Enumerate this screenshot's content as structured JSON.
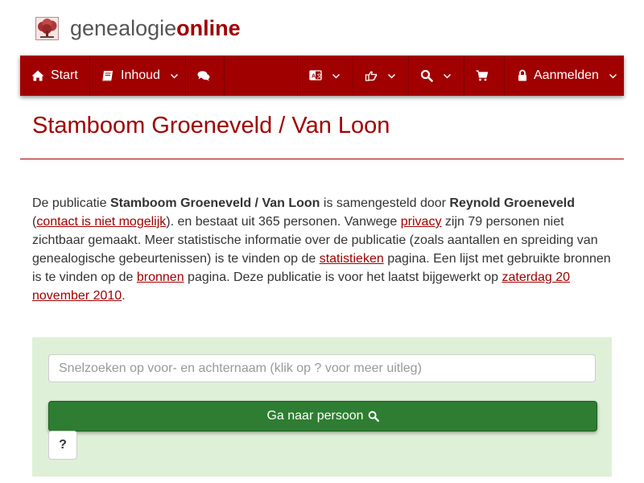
{
  "logo": {
    "text_plain": "genealogie",
    "text_bold": "online",
    "icon": "tree-icon"
  },
  "navbar": {
    "start": {
      "label": "Start",
      "icon": "home-icon"
    },
    "inhoud": {
      "label": "Inhoud",
      "icon": "book-icon"
    },
    "chat_icon": "comments-icon",
    "language_icon": "language-icon",
    "hand_icon": "hand-pointer-icon",
    "search_icon": "search-icon",
    "cart_icon": "shopping-cart-icon",
    "login": {
      "label": "Aanmelden",
      "icon": "lock-icon"
    }
  },
  "page": {
    "title": "Stamboom Groeneveld / Van Loon"
  },
  "intro": {
    "t1": "De publicatie ",
    "publication": "Stamboom Groeneveld / Van Loon",
    "t2": " is samengesteld door ",
    "author": "Reynold Groeneveld",
    "t3": " (",
    "contact_link": "contact is niet mogelijk",
    "t4": "). en bestaat uit 365 personen. Vanwege ",
    "privacy_link": "privacy",
    "t5": " zijn 79 personen niet zichtbaar gemaakt. Meer statistische informatie over de publicatie (zoals aantallen en spreiding van genealogische gebeurtenissen) is te vinden op de ",
    "stats_link": "statistieken",
    "t6": " pagina. Een lijst met gebruikte bronnen is te vinden op de ",
    "sources_link": "bronnen",
    "t7": " pagina. Deze publicatie is voor het laatst bijgewerkt op ",
    "date_link": "zaterdag 20 november 2010",
    "t8": "."
  },
  "search": {
    "placeholder": "Snelzoeken op voor- en achternaam (klik op ? voor meer uitleg)",
    "value": "",
    "button_label": "Ga naar persoon",
    "help_label": "?"
  },
  "colors": {
    "brand": "#a00000",
    "panel_bg": "#dff0d8",
    "button_green": "#2e7d32"
  }
}
